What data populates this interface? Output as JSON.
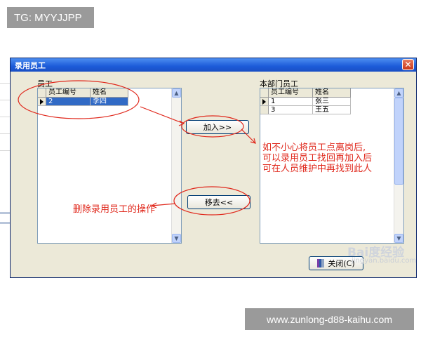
{
  "overlay": {
    "tag": "TG: MYYJJPP",
    "url": "www.zunlong-d88-kaihu.com"
  },
  "dialog": {
    "title": "录用员工",
    "close_glyph": "✕",
    "left_group": {
      "label": "员工",
      "columns": [
        "员工编号",
        "姓名"
      ],
      "rows": [
        {
          "id": "2",
          "name": "李四",
          "selected": true
        }
      ]
    },
    "right_group": {
      "label": "本部门员工",
      "columns": [
        "员工编号",
        "姓名"
      ],
      "rows": [
        {
          "id": "1",
          "name": "张三",
          "selected": false
        },
        {
          "id": "3",
          "name": "王五",
          "selected": false
        }
      ]
    },
    "add_button": "加入>>",
    "remove_button": "移去<<",
    "close_button": "关闭(C)"
  },
  "annotations": {
    "right_lines": [
      "如不小心将员工点离岗后,",
      "可以录用员工找回再加入后",
      "可在人员维护中再找到此人"
    ],
    "left_text": "删除录用员工的操作",
    "color": "#e0281c"
  },
  "watermark": {
    "text": "Bai度经验",
    "sub": "jingyan.baidu.com"
  },
  "colors": {
    "titlebar": "#1c5bd9",
    "selection": "#316ac5",
    "dialog_bg": "#ece9d8"
  }
}
